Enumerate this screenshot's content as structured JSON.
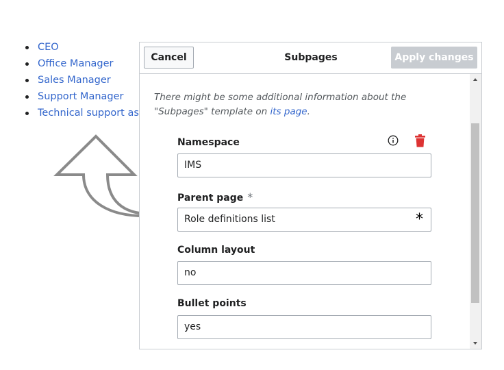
{
  "background_list": {
    "items": [
      {
        "label": "CEO"
      },
      {
        "label": "Office Manager"
      },
      {
        "label": "Sales Manager"
      },
      {
        "label": "Support Manager"
      },
      {
        "label": "Technical support assi"
      }
    ]
  },
  "dialog": {
    "title": "Subpages",
    "cancel_label": "Cancel",
    "apply_label": "Apply changes",
    "info_text_before": "There might be some additional information about the \"Subpages\" template on ",
    "info_link": "its page",
    "info_text_after": ".",
    "fields": [
      {
        "label": "Namespace",
        "value": "IMS"
      },
      {
        "label": "Parent page",
        "required_mark": "*",
        "value": "Role definitions list",
        "value_mark": "*"
      },
      {
        "label": "Column layout",
        "value": "no"
      },
      {
        "label": "Bullet points",
        "value": "yes"
      }
    ]
  },
  "colors": {
    "link": "#3366cc",
    "delete_icon": "#d33",
    "apply_disabled_bg": "#c8ccd1",
    "border": "#a2a9b1"
  },
  "icons": [
    "info-icon",
    "trash-icon",
    "arrow-up-icon"
  ]
}
